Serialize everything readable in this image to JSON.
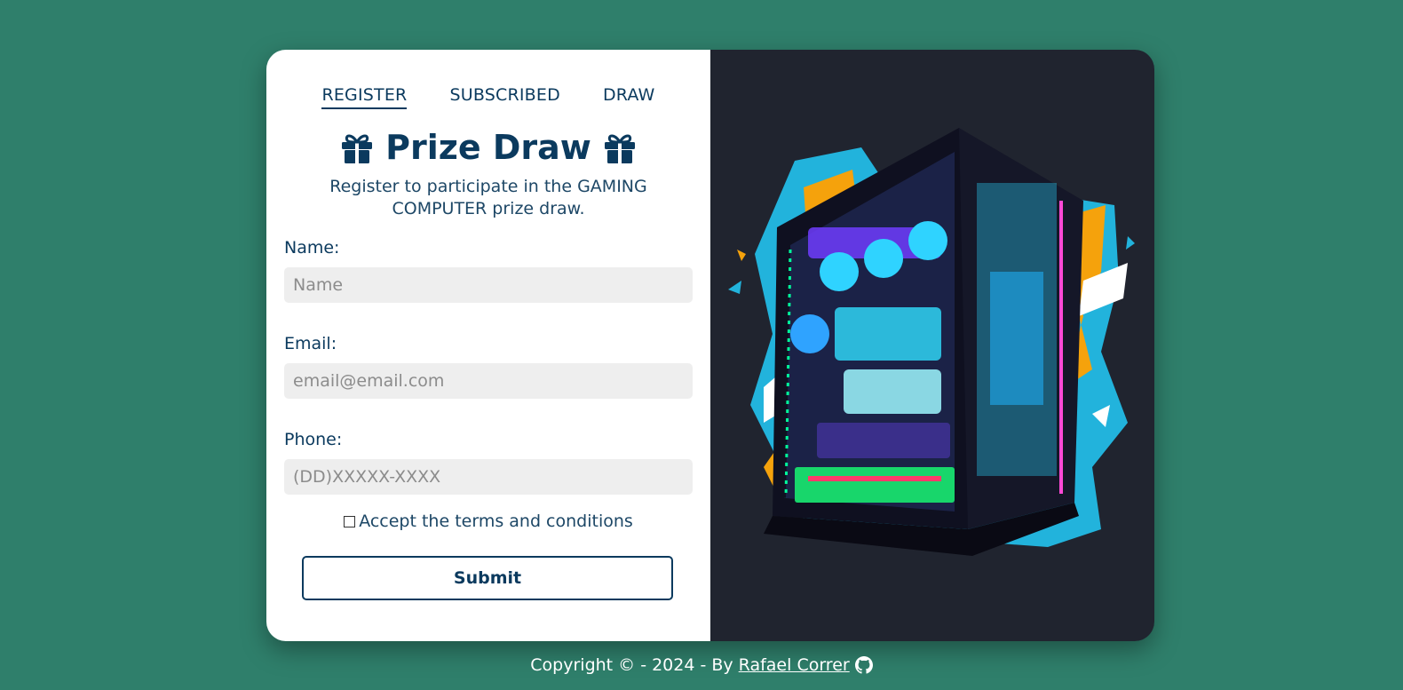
{
  "tabs": [
    {
      "label": "REGISTER",
      "active": true
    },
    {
      "label": "SUBSCRIBED",
      "active": false
    },
    {
      "label": "DRAW",
      "active": false
    }
  ],
  "title": {
    "text": "Prize Draw",
    "left_icon": "gift-icon",
    "right_icon": "gift-icon"
  },
  "subtitle": "Register to participate in the GAMING COMPUTER prize draw.",
  "form": {
    "name_label": "Name:",
    "name_placeholder": "Name",
    "email_label": "Email:",
    "email_placeholder": "email@email.com",
    "phone_label": "Phone:",
    "phone_placeholder": "(DD)XXXXX-XXXX",
    "terms_label": "Accept the terms and conditions",
    "terms_checked": false,
    "submit_label": "Submit"
  },
  "image": {
    "icon": "gaming-pc-image"
  },
  "footer": {
    "copyright_text": "Copyright © - 2024 - By",
    "author_link": "Rafael Correr",
    "author_icon": "github-icon"
  },
  "colors": {
    "background": "#2f7f6b",
    "primary": "#0b3a5e",
    "image_panel_bg": "#20242f",
    "input_bg": "#eeeeee"
  }
}
